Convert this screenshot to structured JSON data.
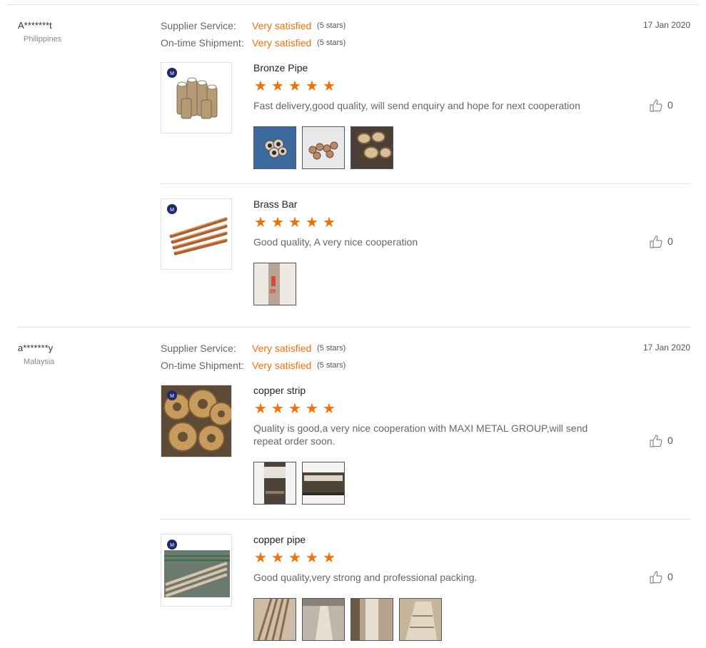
{
  "reviews": [
    {
      "buyer": "A*******t",
      "country": "Philippines",
      "date": "17 Jan 2020",
      "supplier_service_label": "Supplier Service:",
      "supplier_service_value": "Very satisfied",
      "supplier_service_stars": "(5 stars)",
      "shipment_label": "On-time Shipment:",
      "shipment_value": "Very satisfied",
      "shipment_stars": "(5 stars)",
      "items": [
        {
          "product": "Bronze Pipe",
          "rating": 5,
          "comment": "Fast delivery,good quality, will send enquiry and hope for next cooperation",
          "likes": "0",
          "photo_count": 3
        },
        {
          "product": "Brass Bar",
          "rating": 5,
          "comment": "Good quality, A very nice cooperation",
          "likes": "0",
          "photo_count": 1
        }
      ]
    },
    {
      "buyer": "a*******y",
      "country": "Malaysia",
      "date": "17 Jan 2020",
      "supplier_service_label": "Supplier Service:",
      "supplier_service_value": "Very satisfied",
      "supplier_service_stars": "(5 stars)",
      "shipment_label": "On-time Shipment:",
      "shipment_value": "Very satisfied",
      "shipment_stars": "(5 stars)",
      "items": [
        {
          "product": "copper strip",
          "rating": 5,
          "comment": "Quality is good,a very nice cooperation with MAXI METAL GROUP,will send repeat order soon.",
          "likes": "0",
          "photo_count": 2
        },
        {
          "product": "copper pipe",
          "rating": 5,
          "comment": "Good quality,very strong and professional packing.",
          "likes": "0",
          "photo_count": 4
        }
      ]
    }
  ],
  "icons": {
    "star": "star-icon",
    "like": "thumbs-up-icon"
  },
  "colors": {
    "accent": "#f27008",
    "divider": "#e3e3e3"
  }
}
